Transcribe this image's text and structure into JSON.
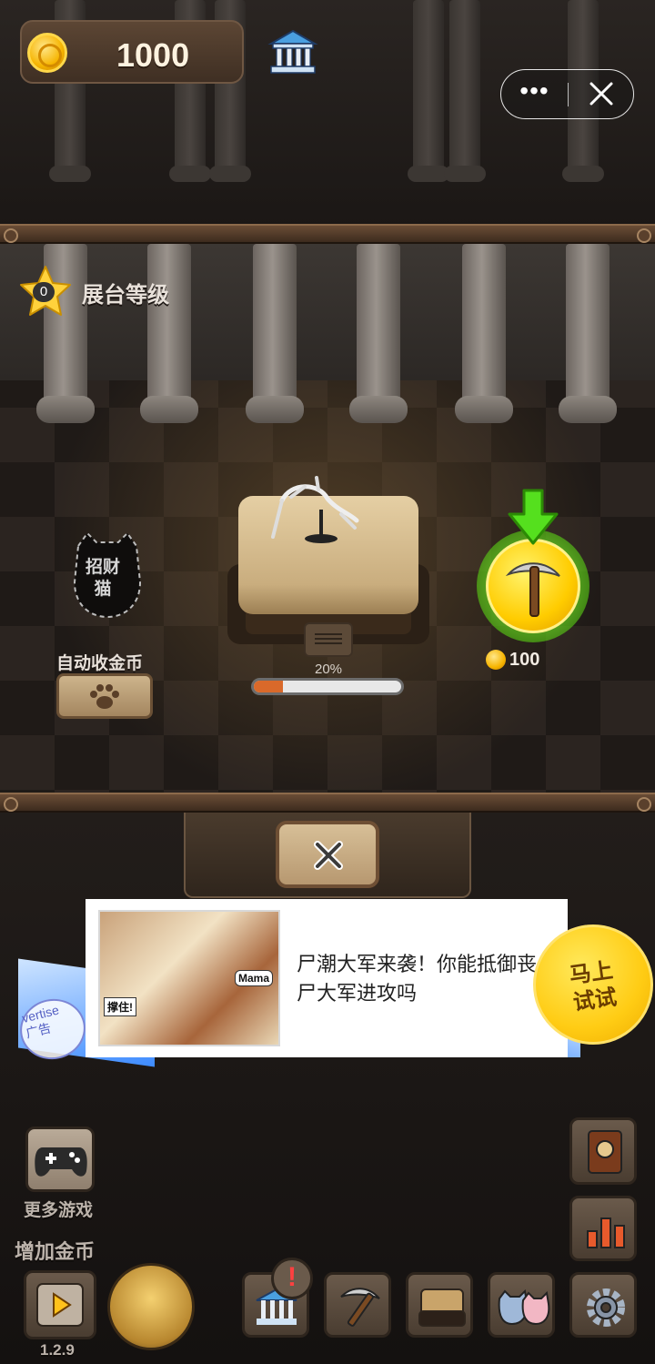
{
  "hud": {
    "coins": "1000",
    "icons": {
      "coin": "gold-coin-icon",
      "museum": "museum-building-icon"
    }
  },
  "mini_program_capsule": {
    "more_icon": "more-dots-icon",
    "close_icon": "close-x-icon"
  },
  "exhibit": {
    "level_value": "0",
    "level_label": "展台等级",
    "progress_text": "20%",
    "progress_fraction": 0.2,
    "lucky_cat_label": "招财猫",
    "auto_collect_label": "自动收金币",
    "auto_collect_icon": "paw-icon",
    "pickaxe_cost": "100",
    "pickaxe_icon": "pickaxe-icon",
    "arrow_icon": "green-down-arrow-icon"
  },
  "drawer": {
    "close_icon": "close-x-icon"
  },
  "ad": {
    "stamp_text": "vertise\n广告",
    "thumb_tag": "撑住!",
    "thumb_bubble": "Mama",
    "headline": "尸潮大军来袭！你能抵御丧尸大军进攻吗",
    "cta": "马上\n试试",
    "colors": {
      "envelope": "#3d8bff",
      "cta": "#ffcc14"
    }
  },
  "bottom_bar": {
    "more_games_label": "更多游戏",
    "add_coins_label": "增加金币",
    "version": "1.2.9",
    "buttons": [
      {
        "name": "museum",
        "icon": "museum-building-icon",
        "badge": "!"
      },
      {
        "name": "pickaxe",
        "icon": "pickaxe-icon"
      },
      {
        "name": "pedestal",
        "icon": "pedestal-icon"
      },
      {
        "name": "cats",
        "icon": "cats-icon"
      },
      {
        "name": "settings",
        "icon": "gear-icon"
      }
    ],
    "side_buttons": [
      {
        "name": "gamepad",
        "icon": "gamepad-icon"
      },
      {
        "name": "book",
        "icon": "book-icon"
      },
      {
        "name": "stats",
        "icon": "bar-chart-icon"
      },
      {
        "name": "video",
        "icon": "video-play-icon"
      }
    ]
  }
}
